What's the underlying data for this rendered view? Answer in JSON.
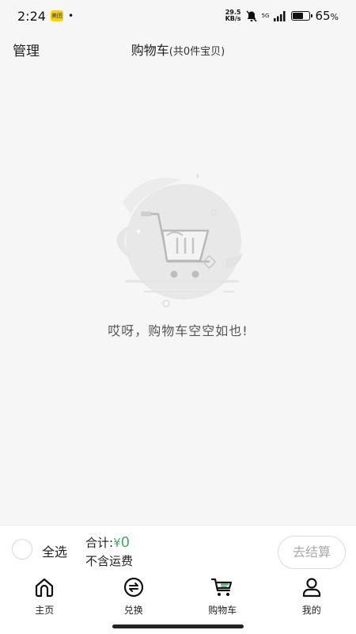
{
  "status_bar": {
    "time": "2:24",
    "app_badge": "美团",
    "dot": "•",
    "net_speed_value": "29.5",
    "net_speed_unit": "KB/s",
    "signal_type": "5G",
    "battery_percent": "65",
    "battery_suffix": "%",
    "battery_level": 0.65
  },
  "header": {
    "manage_label": "管理",
    "title": "购物车",
    "count_text": "(共0件宝贝)"
  },
  "empty_state": {
    "message": "哎呀，购物车空空如也!"
  },
  "checkout": {
    "select_all_label": "全选",
    "total_label": "合计:",
    "currency": "¥",
    "total_value": "0",
    "shipping_note": "不含运费",
    "checkout_button": "去结算"
  },
  "tabs": [
    {
      "label": "主页",
      "icon": "home-icon"
    },
    {
      "label": "兑换",
      "icon": "exchange-icon"
    },
    {
      "label": "购物车",
      "icon": "cart-icon"
    },
    {
      "label": "我的",
      "icon": "profile-icon"
    }
  ],
  "colors": {
    "accent_green": "#3fae5e",
    "background": "#f6f6f6"
  }
}
